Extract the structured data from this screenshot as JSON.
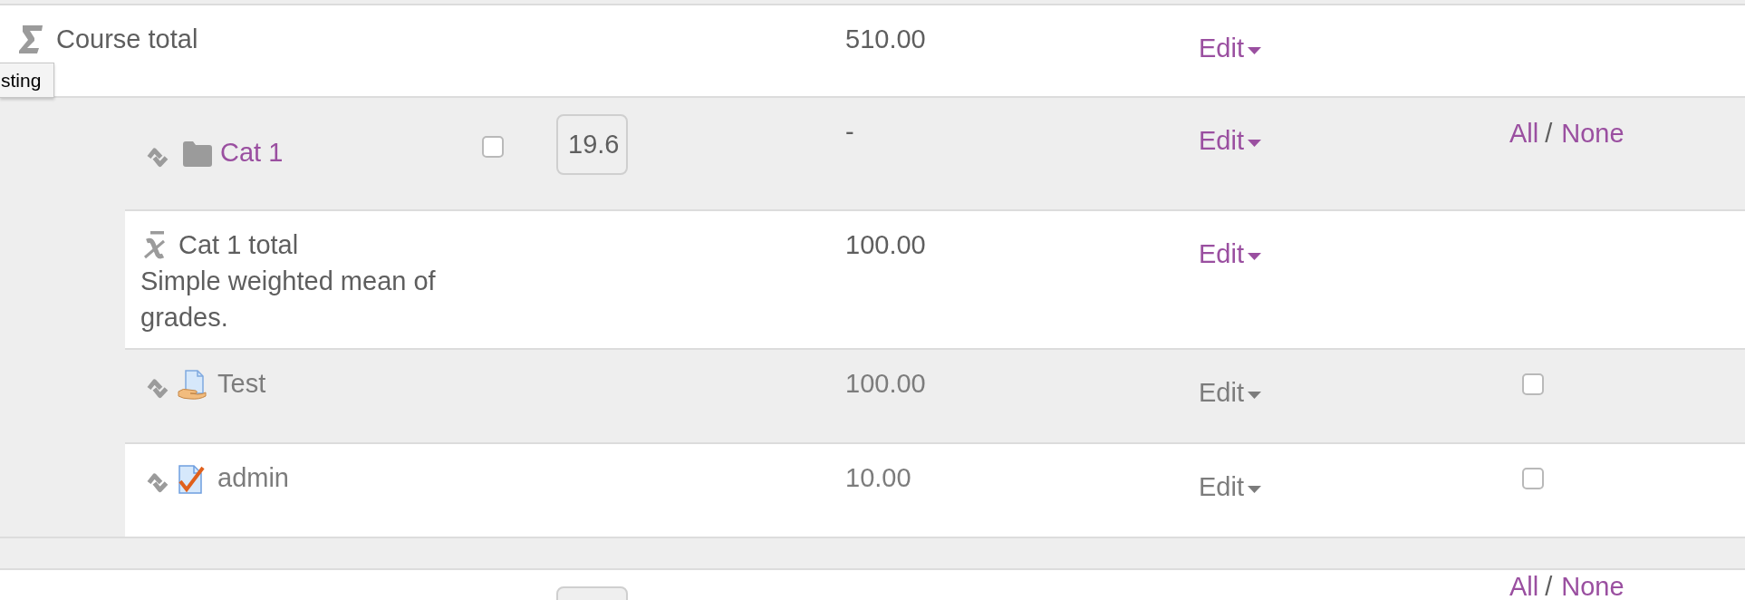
{
  "tooltip": {
    "text": "sting"
  },
  "rows": [
    {
      "kind": "total",
      "name": "Course total",
      "dimmed": false,
      "value": "510.00",
      "action": "Edit"
    },
    {
      "kind": "category",
      "name": "Cat 1",
      "dimmed": false,
      "checked": false,
      "weight": "19.6",
      "value": "-",
      "action": "Edit",
      "select": {
        "all": "All",
        "separator": "/",
        "none": "None"
      },
      "children": [
        {
          "kind": "total",
          "name": "Cat 1 total",
          "description": "Simple weighted mean of grades.",
          "dimmed": false,
          "value": "100.00",
          "action": "Edit"
        },
        {
          "kind": "assignment",
          "name": "Test",
          "dimmed": true,
          "value": "100.00",
          "action": "Edit",
          "checked": false
        },
        {
          "kind": "quiz",
          "name": "admin",
          "dimmed": true,
          "value": "10.00",
          "action": "Edit",
          "checked": false
        }
      ]
    },
    {
      "kind": "category",
      "select": {
        "all": "All",
        "separator": "/",
        "none": "None"
      }
    }
  ]
}
